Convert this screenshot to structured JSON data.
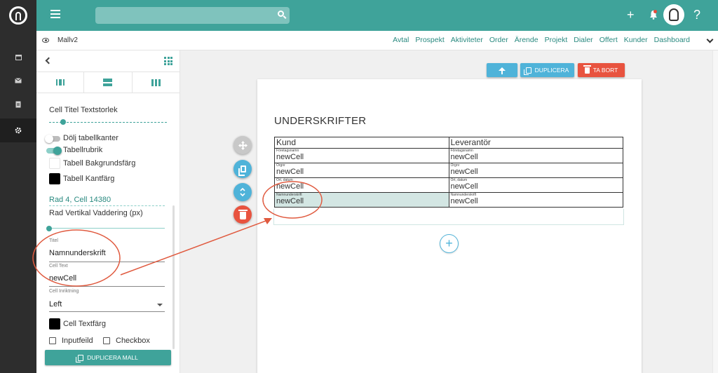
{
  "topbar": {
    "search_placeholder": "",
    "add_icon": "+",
    "help_icon": "?"
  },
  "navbar": {
    "template_name": "Mallv2",
    "links": [
      "Avtal",
      "Prospekt",
      "Aktiviteter",
      "Order",
      "Ärende",
      "Projekt",
      "Dialer",
      "Offert",
      "Kunder",
      "Dashboard"
    ]
  },
  "panel": {
    "cell_title_size_label": "Cell Titel Textstorlek",
    "hide_borders_label": "Dölj tabellkanter",
    "table_header_label": "Tabellrubrik",
    "bg_color_label": "Tabell Bakgrundsfärg",
    "border_color_label": "Tabell Kantfärg",
    "row_cell_title": "Rad 4, Cell 14380",
    "row_padding_label": "Rad Vertikal Vaddering (px)",
    "title_field_label": "Titel",
    "title_field_value": "Namnunderskrift",
    "cell_text_label": "Cell Text",
    "cell_text_value": "newCell",
    "alignment_label": "Cell Inriktning",
    "alignment_value": "Left",
    "text_color_label": "Cell Textfärg",
    "inputfield_label": "Inputfeild",
    "checkbox_label": "Checkbox",
    "duplicate_template_label": "DUPLICERA MALL"
  },
  "canvas": {
    "duplicate_label": "DUPLICERA",
    "delete_label": "TA BORT",
    "section_title": "UNDERSKRIFTER",
    "table": {
      "headers": [
        "Kund",
        "Leverantör"
      ],
      "rows": [
        [
          {
            "title": "Företagsnamn",
            "value": "newCell"
          },
          {
            "title": "Företagsnamn",
            "value": "newCell"
          }
        ],
        [
          {
            "title": "Orgnr",
            "value": "newCell"
          },
          {
            "title": "Orgnr",
            "value": "newCell"
          }
        ],
        [
          {
            "title": "Ort, datum",
            "value": "newCell"
          },
          {
            "title": "Ort, datum",
            "value": "newCell"
          }
        ],
        [
          {
            "title": "Namnunderskrift",
            "value": "newCell"
          },
          {
            "title": "Namnunderskrift",
            "value": "newCell"
          }
        ]
      ]
    },
    "add_label": "+"
  },
  "colors": {
    "brand": "#3fa39a",
    "accent_blue": "#4fb3d9",
    "danger": "#e8533f",
    "annotation": "#e05a3f"
  }
}
